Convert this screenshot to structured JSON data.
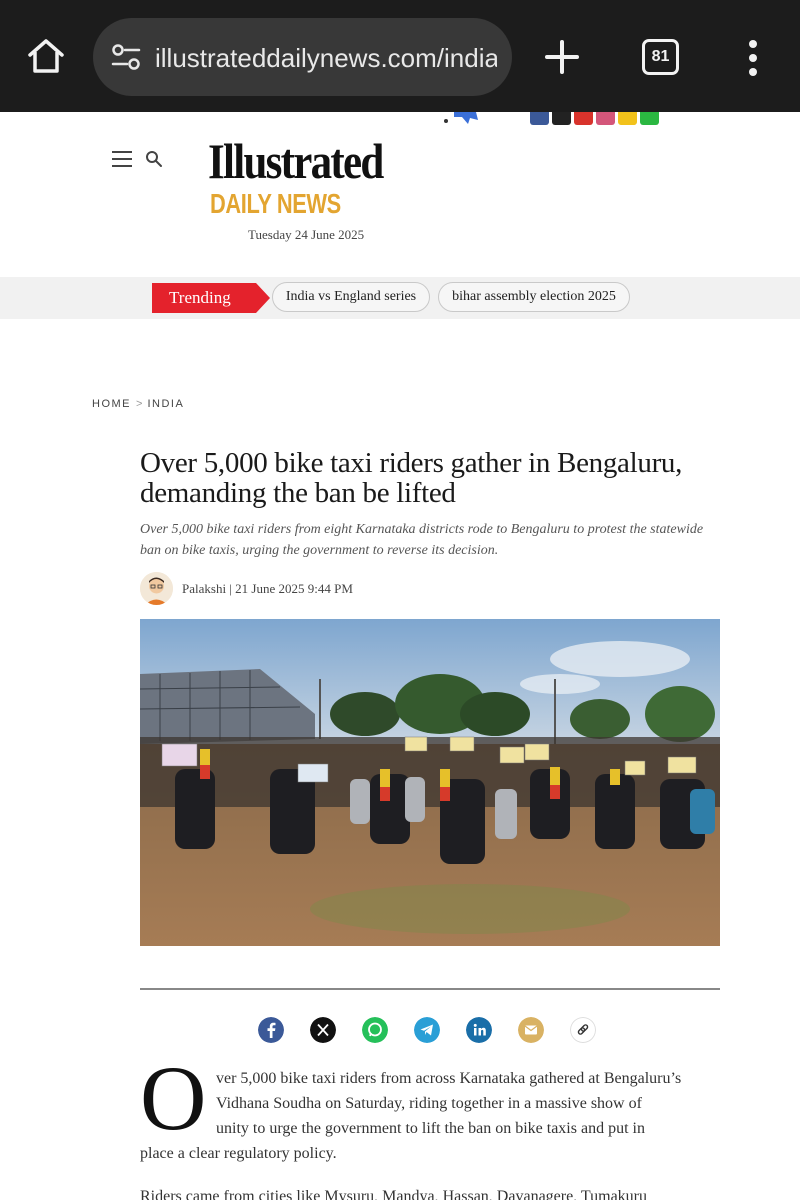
{
  "browser": {
    "url": "illustrateddailynews.com/india/",
    "tab_count": "81",
    "icons": [
      "home-icon",
      "site-settings-icon",
      "new-tab-icon",
      "tabs-icon",
      "more-menu-icon"
    ]
  },
  "header": {
    "logo_main": "Illustrated",
    "logo_sub": "DAILY NEWS",
    "date": "Tuesday 24 June 2025",
    "brand_colors": {
      "logo_sub": "#e3a531",
      "trending": "#e4222c"
    }
  },
  "trending": {
    "label": "Trending",
    "topics": [
      "India vs England series",
      "bihar assembly election 2025"
    ]
  },
  "breadcrumb": {
    "home": "HOME",
    "section": "INDIA",
    "separator": ">"
  },
  "article": {
    "headline": "Over 5,000 bike taxi riders gather in Bengaluru, demanding the ban be lifted",
    "summary": "Over 5,000 bike taxi riders from eight Karnataka districts rode to Bengaluru to protest the statewide ban on bike taxis, urging the government to reverse its decision.",
    "author": "Palakshi",
    "published": "21 June 2025 9:44 PM",
    "byline_separator": "|",
    "photo_description_icon": "news-photo",
    "share": [
      "facebook-share",
      "x-share",
      "whatsapp-share",
      "telegram-share",
      "linkedin-share",
      "email-share",
      "copy-link"
    ],
    "dropcap": "O",
    "para1_lines": [
      "ver 5,000 bike taxi riders from across Karnataka gathered at Bengaluru’s",
      "Vidhana Soudha on Saturday, riding together in a massive show of",
      "unity to urge the government to lift the ban on bike taxis and put in",
      "place a clear regulatory policy."
    ],
    "para2_partial": "Riders came from cities like Mysuru, Mandya, Hassan, Davanagere, Tumakuru"
  }
}
